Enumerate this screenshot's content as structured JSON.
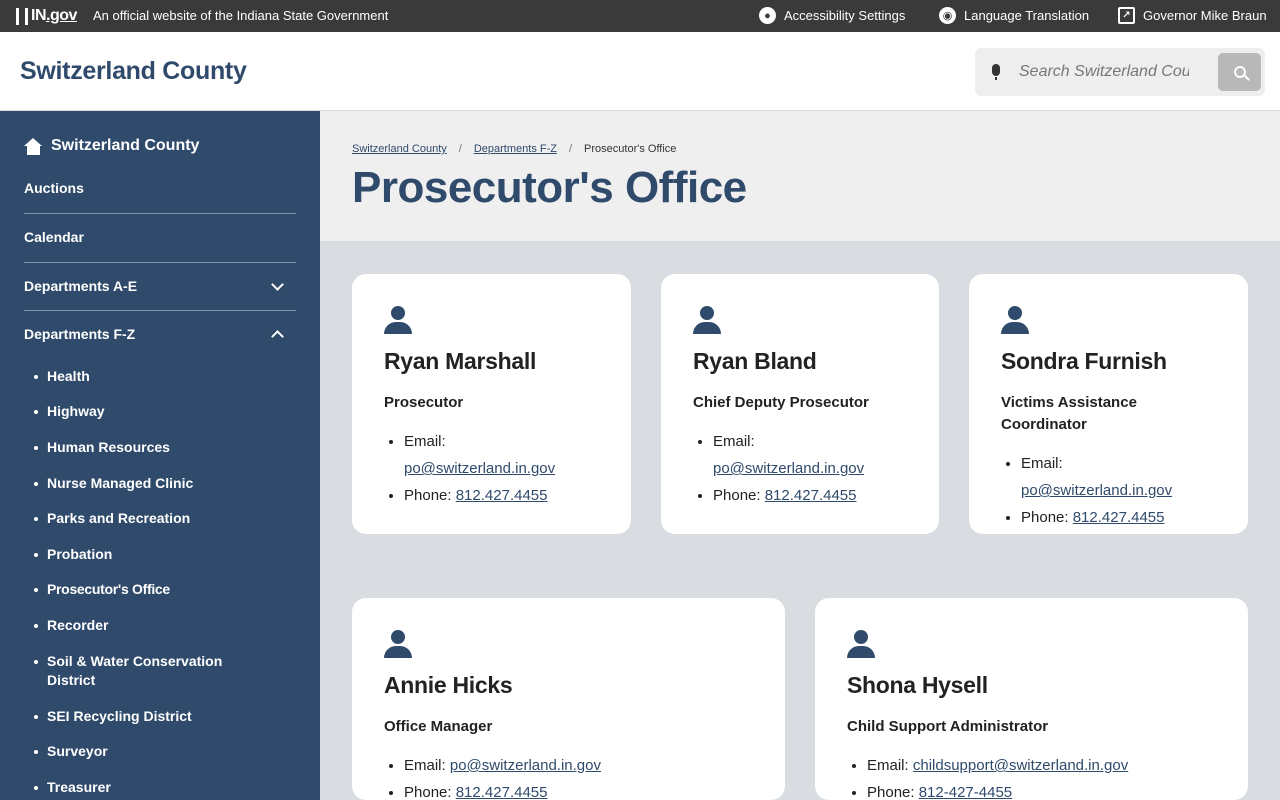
{
  "topbar": {
    "logo_in": "IN",
    "logo_gov": ".gov",
    "official": "An official website of the Indiana State Government",
    "accessibility": "Accessibility Settings",
    "language": "Language Translation",
    "governor": "Governor Mike Braun"
  },
  "header": {
    "site_title": "Switzerland County",
    "search_placeholder": "Search Switzerland County"
  },
  "sidebar": {
    "home": "Switzerland County",
    "items": [
      "Auctions",
      "Calendar",
      "Departments A-E",
      "Departments F-Z"
    ],
    "sub_items": [
      "Health",
      "Highway",
      "Human Resources",
      "Nurse Managed Clinic",
      "Parks and Recreation",
      "Probation",
      "Prosecutor's Office",
      "Recorder",
      "Soil & Water Conservation District",
      "SEI Recycling District",
      "Surveyor",
      "Treasurer"
    ]
  },
  "breadcrumb": {
    "crumb1": "Switzerland County",
    "crumb2": "Departments F-Z",
    "crumb3": "Prosecutor's Office",
    "separator": "/"
  },
  "page_title": "Prosecutor's Office",
  "contact_labels": {
    "email": "Email:",
    "phone": "Phone:"
  },
  "staff": [
    {
      "name": "Ryan Marshall",
      "role": "Prosecutor",
      "email": "po@switzerland.in.gov",
      "phone": "812.427.4455"
    },
    {
      "name": "Ryan Bland",
      "role": "Chief Deputy Prosecutor",
      "email": "po@switzerland.in.gov",
      "phone": "812.427.4455"
    },
    {
      "name": "Sondra Furnish",
      "role": "Victims Assistance Coordinator",
      "email": "po@switzerland.in.gov",
      "phone": "812.427.4455"
    },
    {
      "name": "Annie Hicks",
      "role": "Office Manager",
      "email": "po@switzerland.in.gov",
      "phone": "812.427.4455"
    },
    {
      "name": "Shona Hysell",
      "role": "Child Support Administrator",
      "email": "childsupport@switzerland.in.gov",
      "phone": "812-427-4455"
    }
  ]
}
